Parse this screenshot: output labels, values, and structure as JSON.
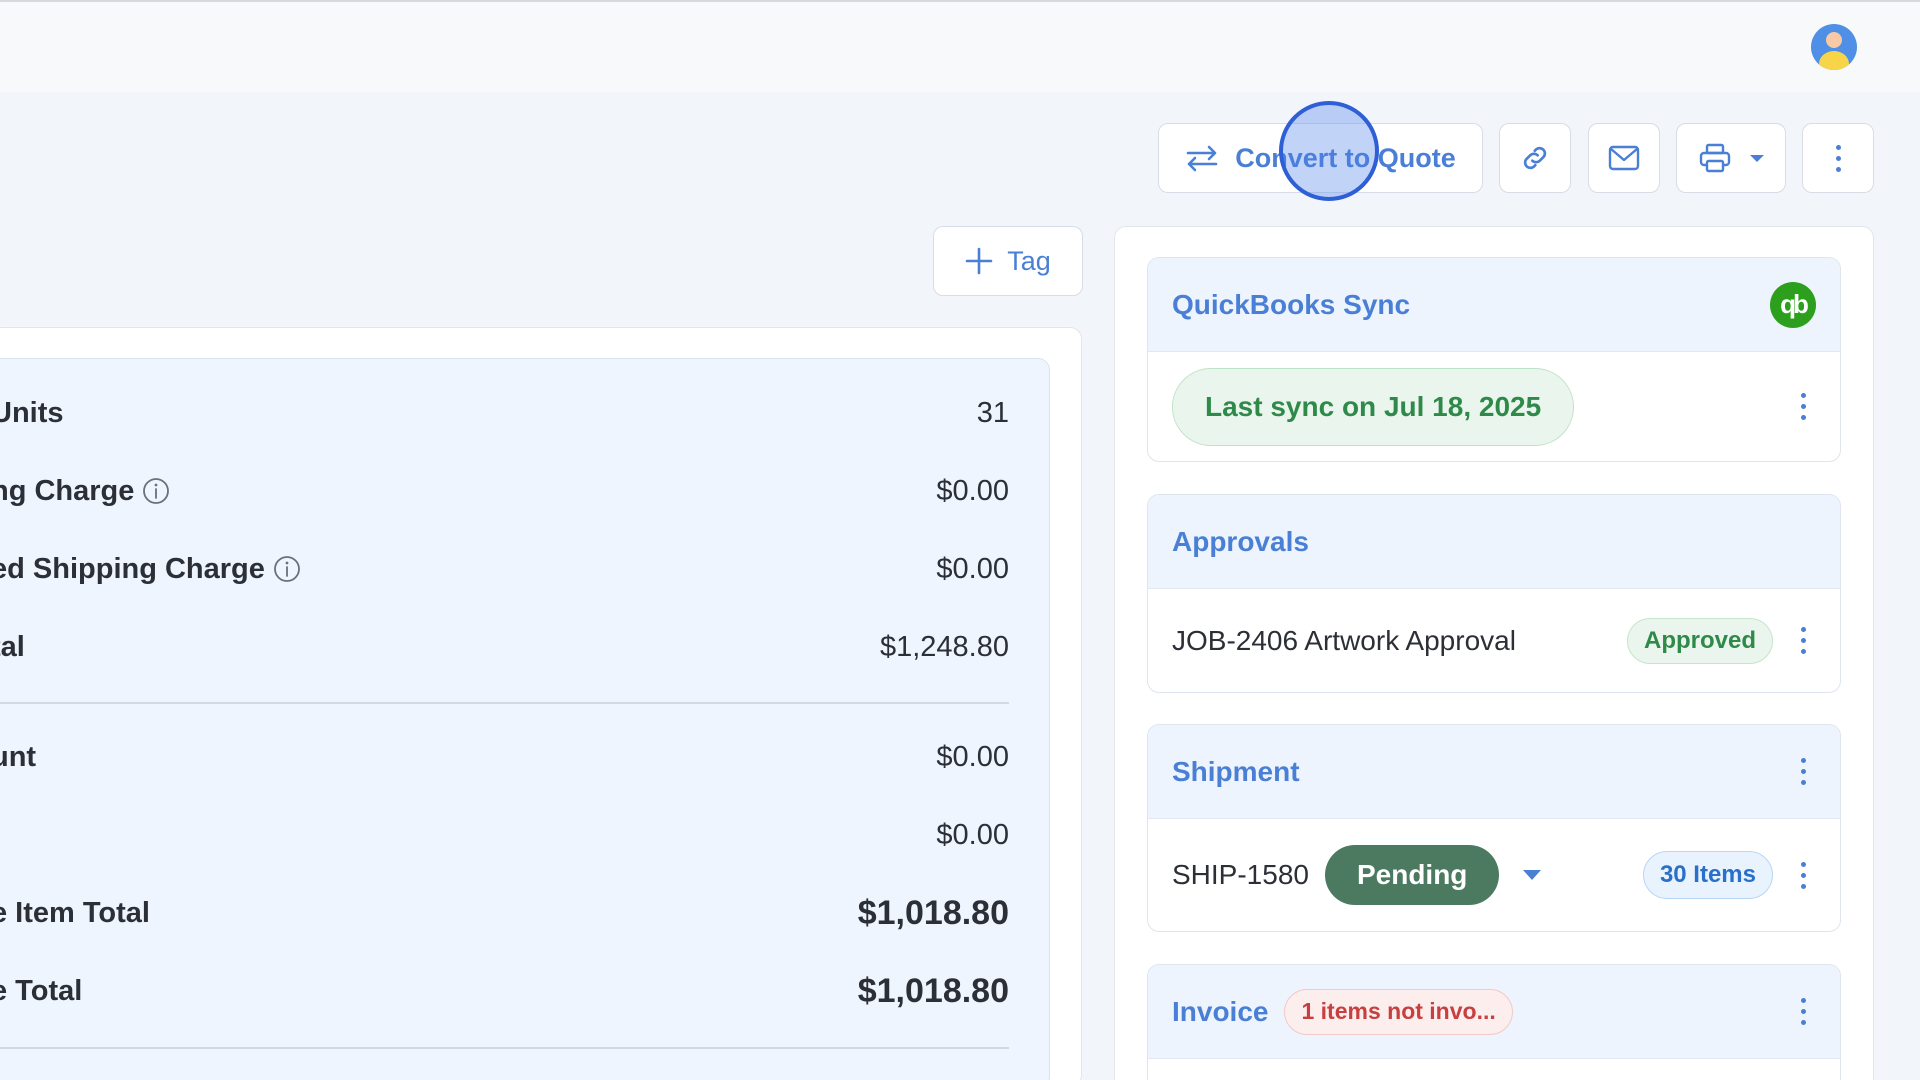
{
  "toolbar": {
    "convert_label": "Convert to Quote",
    "tag_label": "Tag"
  },
  "summary": {
    "rows": [
      {
        "label": "Units",
        "value": "31"
      },
      {
        "label": "ng Charge",
        "value": "$0.00"
      },
      {
        "label": "ed Shipping Charge",
        "value": "$0.00"
      },
      {
        "label": "tal",
        "value": "$1,248.80"
      },
      {
        "label": "unt",
        "value": "$0.00"
      },
      {
        "label": "",
        "value": "$0.00"
      },
      {
        "label": "e Item Total",
        "value": "$1,018.80"
      },
      {
        "label": "e Total",
        "value": "$1,018.80"
      }
    ]
  },
  "quickbooks": {
    "title": "QuickBooks Sync",
    "logo_text": "qb",
    "status": "Last sync on Jul 18, 2025"
  },
  "approvals": {
    "title": "Approvals",
    "item": "JOB-2406 Artwork Approval",
    "status": "Approved"
  },
  "shipment": {
    "title": "Shipment",
    "id": "SHIP-1580",
    "status": "Pending",
    "items": "30 Items"
  },
  "invoice": {
    "title": "Invoice",
    "alert": "1 items not invo..."
  },
  "colors": {
    "accent": "#4a7fd6",
    "success": "#2f8a4a",
    "pending": "#4b7a61",
    "danger": "#c73f3f"
  }
}
